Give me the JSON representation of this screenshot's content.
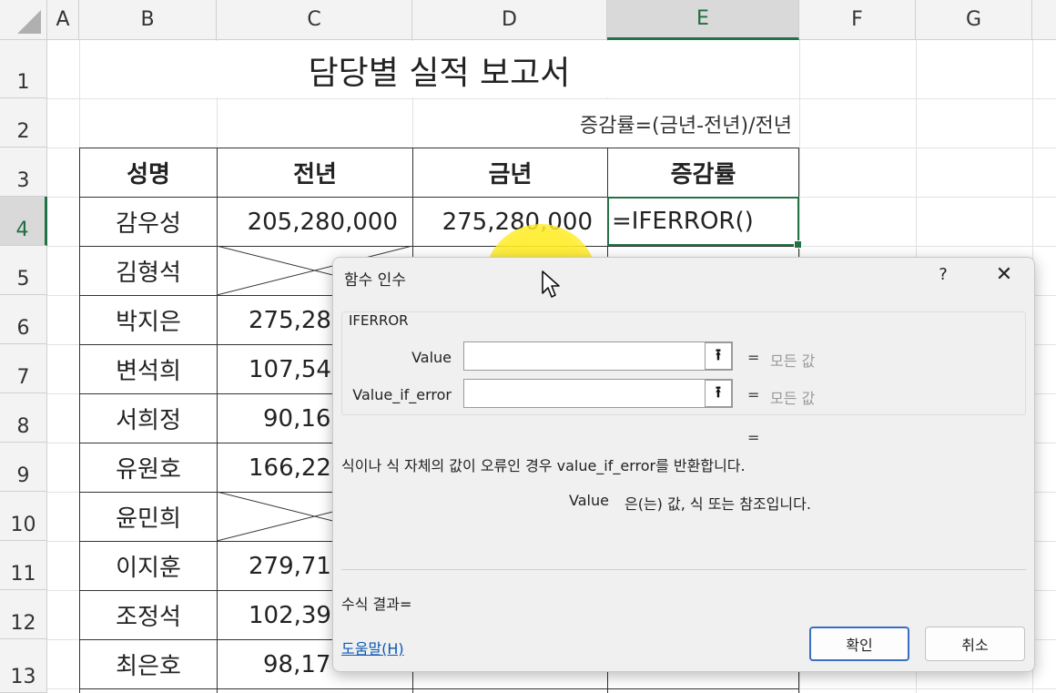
{
  "columns": [
    "A",
    "B",
    "C",
    "D",
    "E",
    "F",
    "G"
  ],
  "rows": [
    "1",
    "2",
    "3",
    "4",
    "5",
    "6",
    "7",
    "8",
    "9",
    "10",
    "11",
    "12",
    "13"
  ],
  "sheet": {
    "title": "담당별 실적 보고서",
    "note": "증감률=(금년-전년)/전년",
    "headers": {
      "name": "성명",
      "prev": "전년",
      "curr": "금년",
      "rate": "증감률"
    },
    "names": [
      "감우성",
      "김형석",
      "박지은",
      "변석희",
      "서희정",
      "유원호",
      "윤민희",
      "이지훈",
      "조정석",
      "최은호"
    ],
    "prev_values": [
      "205,280,000",
      "",
      "275,28",
      "107,54",
      "90,16",
      "166,22",
      "",
      "279,71",
      "102,39",
      "98,17"
    ],
    "curr_values": [
      "275,280,000",
      "",
      "",
      "",
      "",
      "",
      "",
      "",
      "",
      ""
    ],
    "active_formula": "=IFERROR()"
  },
  "dialog": {
    "title": "함수 인수",
    "help": "?",
    "close": "✕",
    "function_name": "IFERROR",
    "args": [
      {
        "label": "Value",
        "value": "",
        "eq": "=",
        "hint": "모든 값"
      },
      {
        "label": "Value_if_error",
        "value": "",
        "eq": "=",
        "hint": "모든 값"
      }
    ],
    "result_eq": "=",
    "description": "식이나 식 자체의 값이 오류인 경우 value_if_error를 반환합니다.",
    "arg_desc_name": "Value",
    "arg_desc": "은(는) 값, 식 또는 참조입니다.",
    "formula_result": "수식 결과=",
    "help_link": "도움말(H)",
    "ok": "확인",
    "cancel": "취소"
  },
  "colors": {
    "excel_green": "#217346",
    "highlight": "#ffec28",
    "link": "#0a58b4"
  }
}
